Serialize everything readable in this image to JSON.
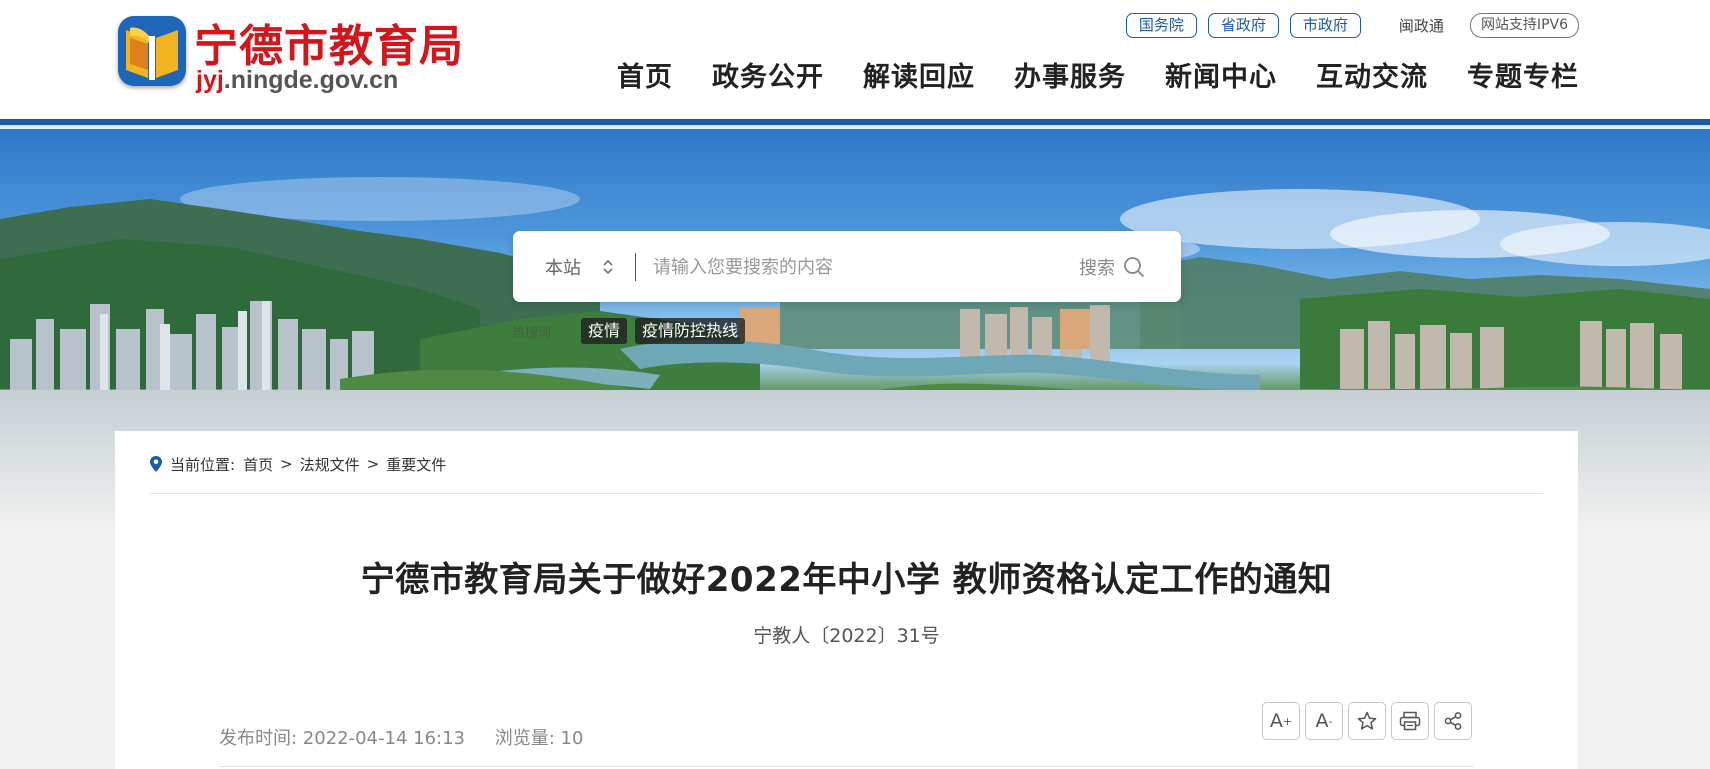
{
  "header": {
    "logo_name": "宁德市教育局",
    "logo_url_red": "jyj",
    "logo_url_rest": ".ningde.gov.cn",
    "top_links": [
      "国务院",
      "省政府",
      "市政府"
    ],
    "min_zheng_tong": "闽政通",
    "ipv6_badge": "网站支持IPV6",
    "nav": [
      "首页",
      "政务公开",
      "解读回应",
      "办事服务",
      "新闻中心",
      "互动交流",
      "专题专栏"
    ]
  },
  "search": {
    "scope": "本站",
    "placeholder": "请输入您要搜索的内容",
    "button_label": "搜索",
    "hot_label": "热搜词",
    "hot_tags": [
      "疫情",
      "疫情防控热线"
    ]
  },
  "breadcrumb": {
    "label": "当前位置:",
    "items": [
      "首页",
      "法规文件",
      "重要文件"
    ],
    "separator": ">"
  },
  "article": {
    "title": "宁德市教育局关于做好2022年中小学 教师资格认定工作的通知",
    "doc_number": "宁教人〔2022〕31号",
    "published": "发布时间: 2022-04-14 16:13",
    "views": "浏览量: 10"
  },
  "tools": {
    "font_increase": "A",
    "font_decrease": "A",
    "plus": "+",
    "minus": "-"
  },
  "colors": {
    "brand_blue": "#1c5ca6",
    "logo_red": "#d4161c"
  },
  "icons": [
    "location-pin-icon",
    "up-down-arrows-icon",
    "search-icon",
    "font-increase-icon",
    "font-decrease-icon",
    "star-icon",
    "printer-icon",
    "share-icon"
  ]
}
